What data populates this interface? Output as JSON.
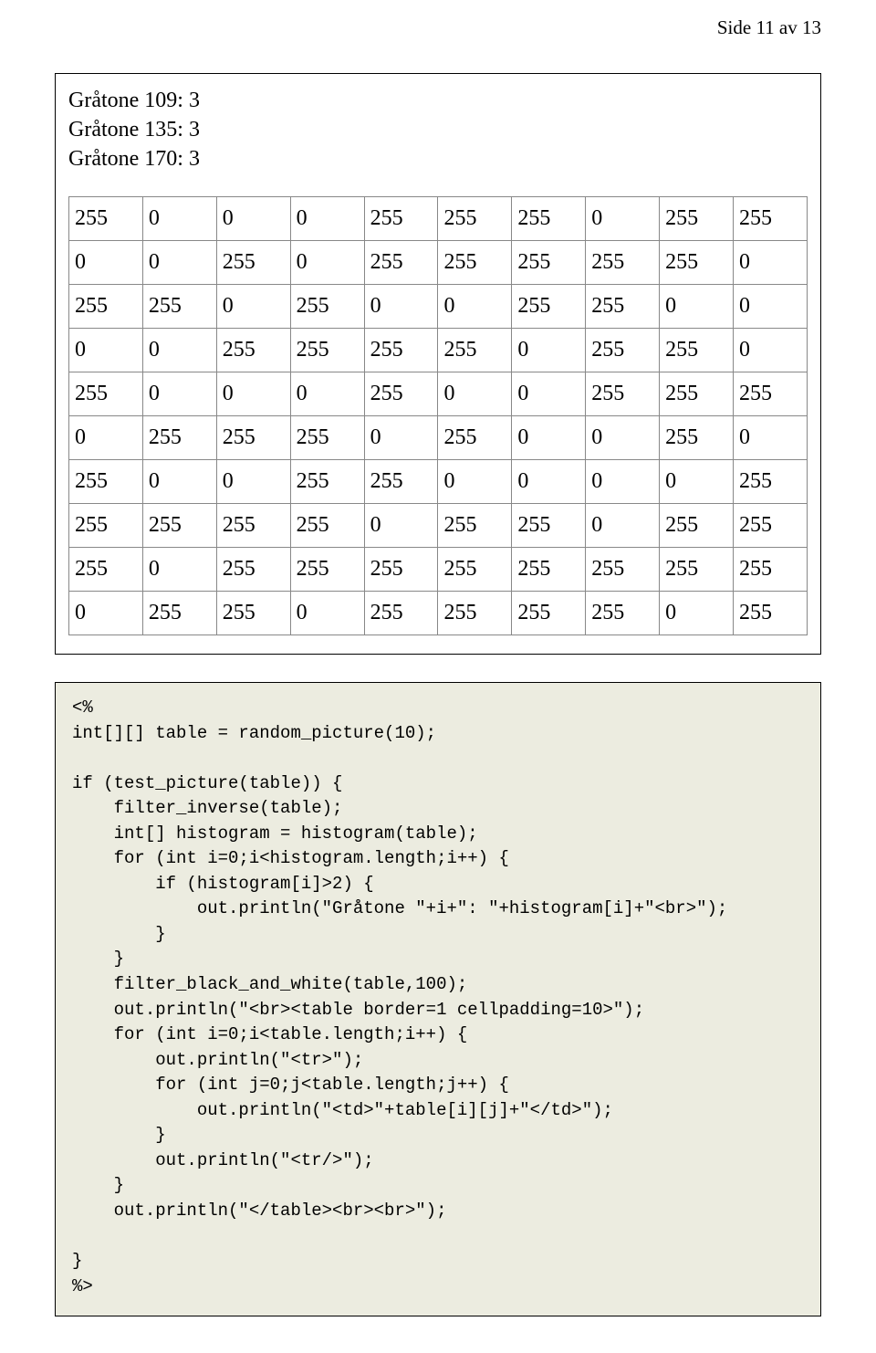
{
  "pageLabel": "Side 11 av 13",
  "graytones": [
    "Gråtone 109: 3",
    "Gråtone 135: 3",
    "Gråtone 170: 3"
  ],
  "table": [
    [
      255,
      0,
      0,
      0,
      255,
      255,
      255,
      0,
      255,
      255
    ],
    [
      0,
      0,
      255,
      0,
      255,
      255,
      255,
      255,
      255,
      0
    ],
    [
      255,
      255,
      0,
      255,
      0,
      0,
      255,
      255,
      0,
      0
    ],
    [
      0,
      0,
      255,
      255,
      255,
      255,
      0,
      255,
      255,
      0
    ],
    [
      255,
      0,
      0,
      0,
      255,
      0,
      0,
      255,
      255,
      255
    ],
    [
      0,
      255,
      255,
      255,
      0,
      255,
      0,
      0,
      255,
      0
    ],
    [
      255,
      0,
      0,
      255,
      255,
      0,
      0,
      0,
      0,
      255
    ],
    [
      255,
      255,
      255,
      255,
      0,
      255,
      255,
      0,
      255,
      255
    ],
    [
      255,
      0,
      255,
      255,
      255,
      255,
      255,
      255,
      255,
      255
    ],
    [
      0,
      255,
      255,
      0,
      255,
      255,
      255,
      255,
      0,
      255
    ]
  ],
  "code": "<%\nint[][] table = random_picture(10);\n\nif (test_picture(table)) {\n    filter_inverse(table);\n    int[] histogram = histogram(table);\n    for (int i=0;i<histogram.length;i++) {\n        if (histogram[i]>2) {\n            out.println(\"Gråtone \"+i+\": \"+histogram[i]+\"<br>\");\n        }\n    }\n    filter_black_and_white(table,100);\n    out.println(\"<br><table border=1 cellpadding=10>\");\n    for (int i=0;i<table.length;i++) {\n        out.println(\"<tr>\");\n        for (int j=0;j<table.length;j++) {\n            out.println(\"<td>\"+table[i][j]+\"</td>\");\n        }\n        out.println(\"<tr/>\");\n    }\n    out.println(\"</table><br><br>\");\n\n}\n%>"
}
